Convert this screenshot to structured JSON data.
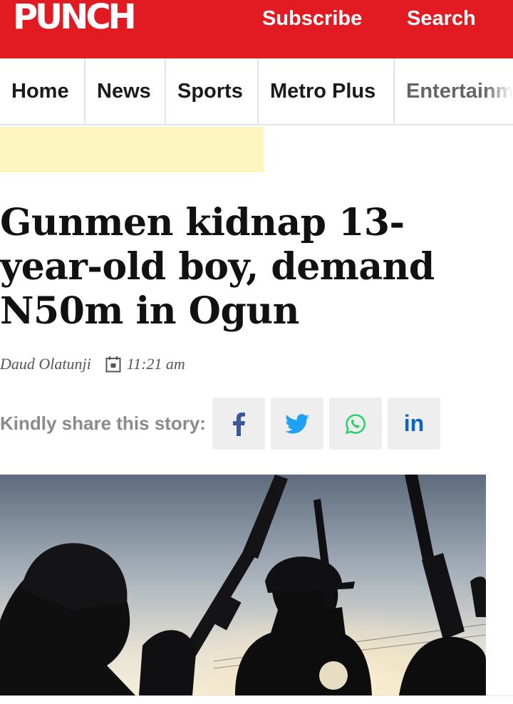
{
  "header": {
    "logo": "PUNCH",
    "subscribe": "Subscribe",
    "search": "Search",
    "brand_color": "#e21b23"
  },
  "nav": {
    "items": [
      {
        "label": "Home"
      },
      {
        "label": "News"
      },
      {
        "label": "Sports"
      },
      {
        "label": "Metro Plus"
      },
      {
        "label": "Entertainm"
      }
    ]
  },
  "article": {
    "headline": "Gunmen kidnap 13-year-old boy, demand N50m in Ogun",
    "author": "Daud Olatunji",
    "time": "11:21 am",
    "share_label": "Kindly share this story:",
    "share_buttons": [
      {
        "icon": "facebook-icon",
        "color": "#3b5998"
      },
      {
        "icon": "twitter-icon",
        "color": "#1da1f2"
      },
      {
        "icon": "whatsapp-icon",
        "color": "#25d366"
      },
      {
        "icon": "linkedin-icon",
        "color": "#0a66c2",
        "text": "in"
      }
    ],
    "image": "silhouette-gunmen-image"
  }
}
